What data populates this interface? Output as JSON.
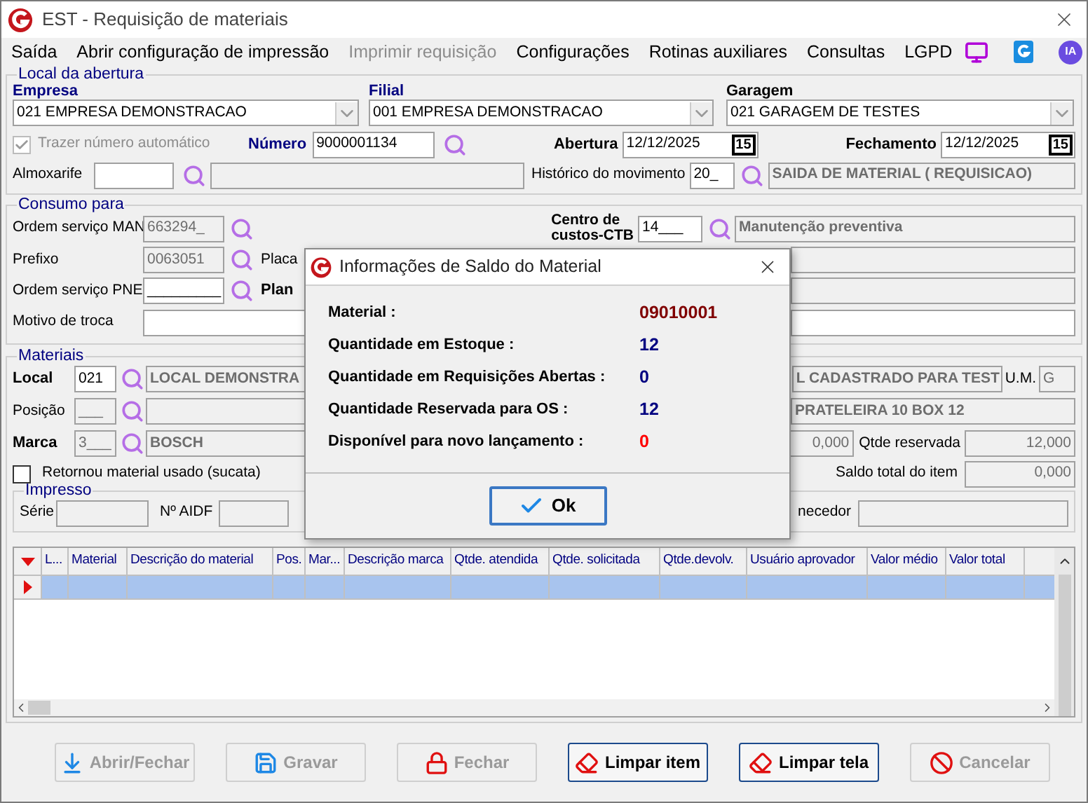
{
  "window": {
    "title": "EST - Requisição de materiais"
  },
  "menu": [
    {
      "label": "Saída",
      "disabled": false
    },
    {
      "label": "Abrir configuração de impressão",
      "disabled": false
    },
    {
      "label": "Imprimir requisição",
      "disabled": true
    },
    {
      "label": "Configurações",
      "disabled": false
    },
    {
      "label": "Rotinas auxiliares",
      "disabled": false
    },
    {
      "label": "Consultas",
      "disabled": false
    },
    {
      "label": "LGPD",
      "disabled": false
    }
  ],
  "menu_ia_badge": "IA",
  "local_abertura": {
    "title": "Local da abertura",
    "empresa": {
      "label": "Empresa",
      "value": "021 EMPRESA DEMONSTRACAO"
    },
    "filial": {
      "label": "Filial",
      "value": "001 EMPRESA DEMONSTRACAO"
    },
    "garagem": {
      "label": "Garagem",
      "value": "021 GARAGEM DE TESTES"
    },
    "trazer_numero": {
      "label": "Trazer número automático",
      "checked": true,
      "disabled": true
    },
    "numero": {
      "label": "Número",
      "value": "9000001134"
    },
    "abertura": {
      "label": "Abertura",
      "value": "12/12/2025",
      "day": "15"
    },
    "fechamento": {
      "label": "Fechamento",
      "value": "12/12/2025",
      "day": "15"
    },
    "almoxarife": {
      "label": "Almoxarife"
    },
    "historico": {
      "label": "Histórico do movimento",
      "code": "20_",
      "description": "SAIDA DE MATERIAL ( REQUISICAO)"
    }
  },
  "consumo": {
    "title": "Consumo para",
    "ordem_man": {
      "label": "Ordem serviço MAN",
      "value": "663294_"
    },
    "centro_custos": {
      "label_line_1": "Centro de",
      "label_line_2": "custos-CTB",
      "code": "14___",
      "description": "Manutenção preventiva"
    },
    "prefixo": {
      "label": "Prefixo",
      "value": "0063051"
    },
    "placa": {
      "label": "Placa"
    },
    "ordem_pne": {
      "label": "Ordem serviço PNE",
      "value": "_________"
    },
    "plano": {
      "label": "Plan"
    },
    "motivo": {
      "label": "Motivo de troca"
    }
  },
  "materiais": {
    "title": "Materiais",
    "local": {
      "label": "Local",
      "code": "021",
      "description_left": "LOCAL DEMONSTRA",
      "description_right": "L CADASTRADO PARA TEST",
      "um_label": "U.M.",
      "um": "G"
    },
    "posicao": {
      "label": "Posição",
      "code": "___",
      "description_right": "PRATELEIRA 10  BOX 12"
    },
    "marca": {
      "label": "Marca",
      "code": "3___",
      "description": "BOSCH",
      "quantity": "0,000",
      "reservada_label": "Qtde reservada",
      "reservada": "12,000"
    },
    "retornou": {
      "label": "Retornou material usado (sucata)",
      "checked": false
    },
    "saldo": {
      "label": "Saldo total do item",
      "value": "0,000"
    },
    "impresso": {
      "title": "Impresso",
      "serie": "Série",
      "aidf": "Nº AIDF",
      "fornecedor": "necedor"
    }
  },
  "table": {
    "columns": [
      "L...",
      "Material",
      "Descrição do material",
      "Pos.",
      "Mar...",
      "Descrição marca",
      "Qtde. atendida",
      "Qtde. solicitada",
      "Qtde.devolv.",
      "Usuário aprovador",
      "Valor médio",
      "Valor total"
    ],
    "rows": [
      {
        "selected": true
      }
    ]
  },
  "buttons": [
    {
      "label": "Abrir/Fechar",
      "kind": "download",
      "disabled": true
    },
    {
      "label": "Gravar",
      "kind": "save",
      "disabled": true
    },
    {
      "label": "Fechar",
      "kind": "lock",
      "disabled": true
    },
    {
      "label": "Limpar item",
      "kind": "eraser",
      "disabled": false
    },
    {
      "label": "Limpar tela",
      "kind": "eraser",
      "disabled": false
    },
    {
      "label": "Cancelar",
      "kind": "ban",
      "disabled": true
    }
  ],
  "dialog": {
    "title": "Informações de Saldo do Material",
    "rows": [
      {
        "label": "Material :",
        "value": "09010001",
        "color": "#800000"
      },
      {
        "label": "Quantidade em Estoque :",
        "value": "12",
        "color": "#000080"
      },
      {
        "label": "Quantidade em Requisições Abertas :",
        "value": "0",
        "color": "#000080"
      },
      {
        "label": "Quantidade Reservada para OS :",
        "value": "12",
        "color": "#000080"
      },
      {
        "label": "Disponível para novo lançamento :",
        "value": "0",
        "color": "#ff0000"
      }
    ],
    "ok": "Ok"
  }
}
